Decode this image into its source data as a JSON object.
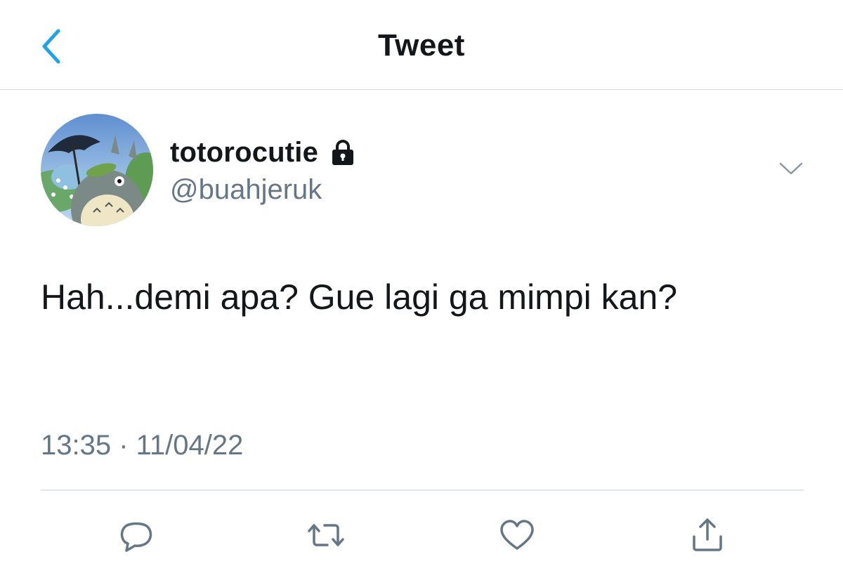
{
  "header": {
    "title": "Tweet",
    "back_icon": "chevron-left-icon",
    "accent_color": "#1da1f2"
  },
  "author": {
    "display_name": "totorocutie",
    "handle": "@buahjeruk",
    "protected_icon": "lock-icon",
    "avatar": "avatar-image"
  },
  "tweet": {
    "text": "Hah...demi apa? Gue lagi ga mimpi kan?",
    "timestamp": "13:35 · 11/04/22"
  },
  "actions": {
    "reply_icon": "reply-icon",
    "retweet_icon": "retweet-icon",
    "like_icon": "heart-icon",
    "share_icon": "share-icon"
  },
  "colors": {
    "text_primary": "#14171a",
    "text_secondary": "#657786",
    "divider": "#e1e8ed"
  }
}
